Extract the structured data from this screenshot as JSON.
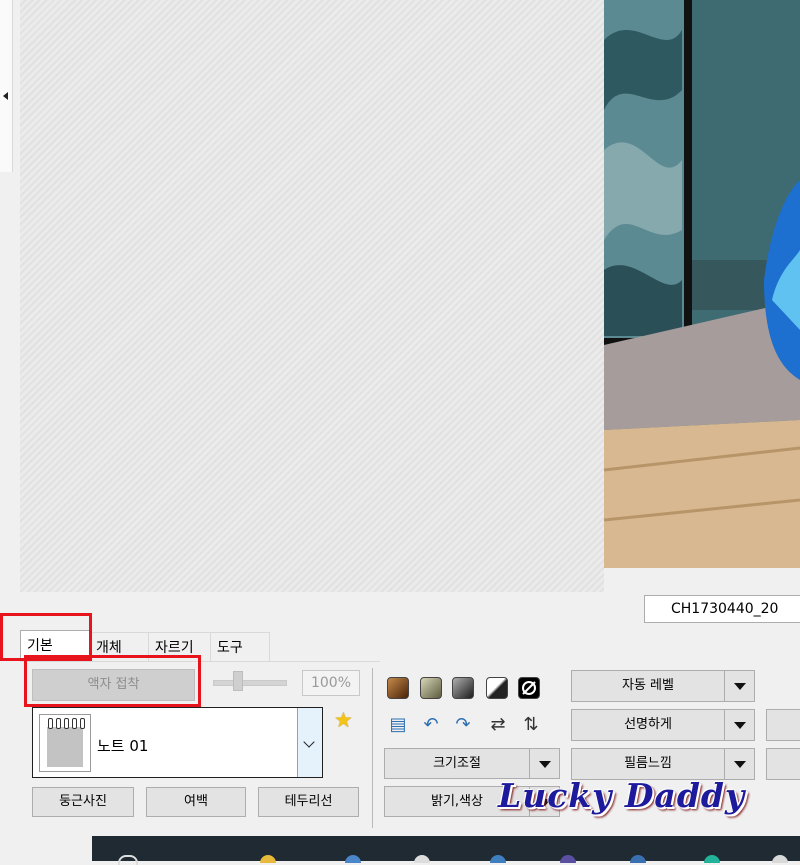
{
  "canvas": {},
  "file": {
    "name": "CH1730440_20"
  },
  "tabs": [
    {
      "label": "기본",
      "active": true
    },
    {
      "label": "개체",
      "active": false
    },
    {
      "label": "자르기",
      "active": false
    },
    {
      "label": "도구",
      "active": false
    }
  ],
  "basic_panel": {
    "apply_frame_label": "액자 접착",
    "zoom_percent": "100%",
    "frame_select": {
      "selected": "노트 01"
    },
    "buttons": [
      "둥근사진",
      "여백",
      "테두리선"
    ]
  },
  "color_swatches": [
    "#6b3a10",
    "#8c8a6c",
    "#3b3b3b",
    "#2a2a2a",
    "#000000"
  ],
  "tool_icons": [
    "stack-icon",
    "rotate-left-icon",
    "rotate-right-icon",
    "flip-horizontal-icon",
    "flip-vertical-icon"
  ],
  "dropdowns": {
    "resize": "크기조절",
    "brightness": "밝기,색상",
    "auto_level": "자동 레벨",
    "sharpen": "선명하게",
    "film": "필름느낌"
  },
  "watermark": "Lucky Daddy",
  "accent_color": "#e8141c"
}
